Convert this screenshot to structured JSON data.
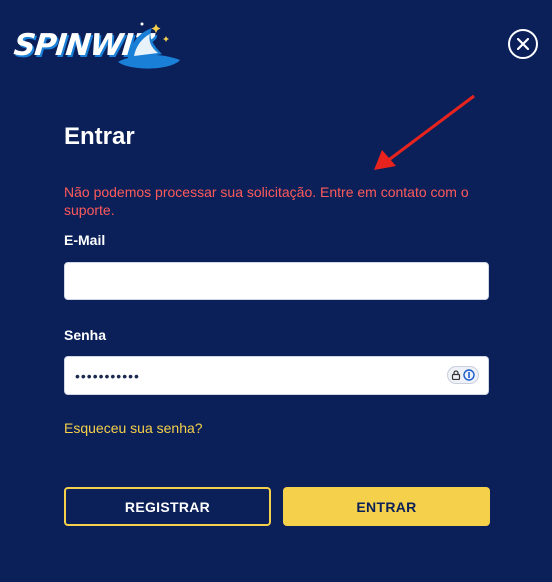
{
  "brand": {
    "logo_text": "SPINWIZ",
    "icon": "wizard-hat-icon"
  },
  "dialog": {
    "close_icon": "close-icon",
    "title": "Entrar",
    "error_message": "Não podemos processar sua solicitação. Entre em contato com o suporte.",
    "email": {
      "label": "E-Mail",
      "value": ""
    },
    "password": {
      "label": "Senha",
      "value": "•••••••••••",
      "manager_icon": "password-manager-icon"
    },
    "forgot_password": "Esqueceu sua senha?",
    "register_button": "REGISTRAR",
    "login_button": "ENTRAR"
  },
  "colors": {
    "background": "#0b2059",
    "accent": "#f5d04a",
    "error": "#ff5a5a",
    "annotation_arrow": "#e8231e"
  }
}
